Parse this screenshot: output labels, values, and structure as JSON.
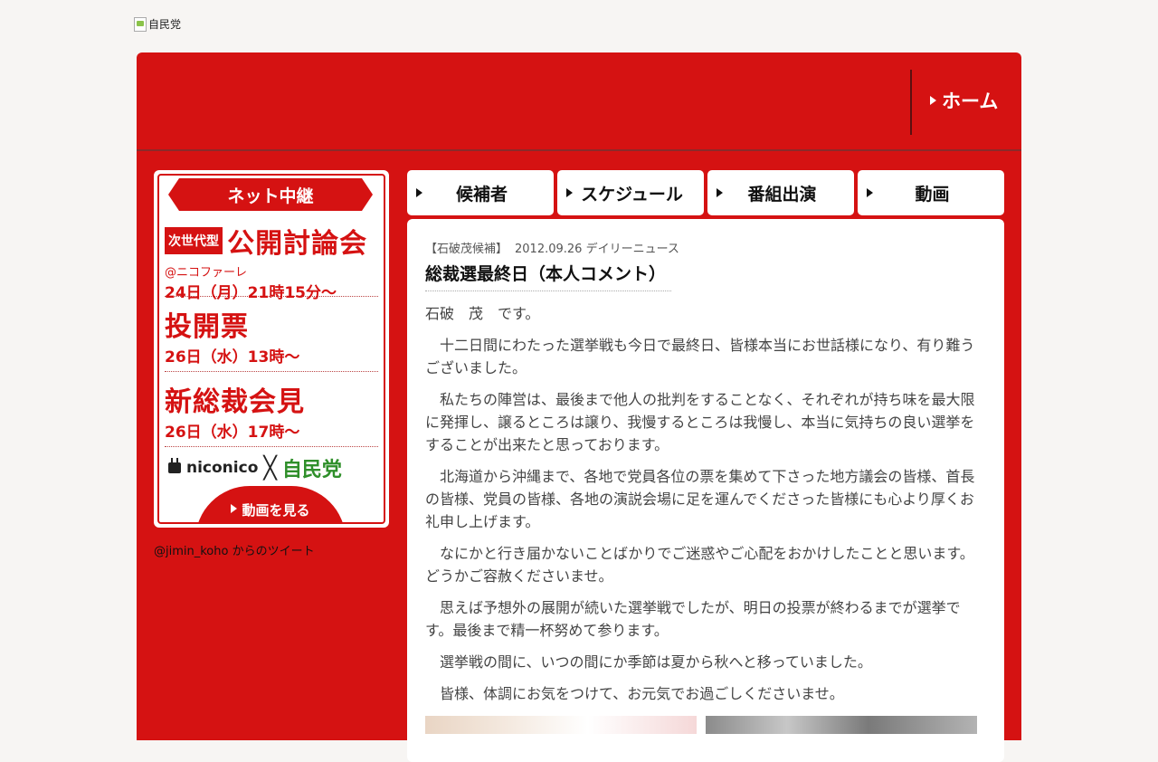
{
  "logo": {
    "alt": "自民党"
  },
  "nav": {
    "home": "ホーム"
  },
  "banner": {
    "ribbon": "ネット中継",
    "next_gen_tag": "次世代型",
    "debate_title": "公開討論会",
    "venue": "@ニコファーレ",
    "debate_time": "24日（月）21時15分～",
    "vote_title": "投開票",
    "vote_time": "26日（水）13時～",
    "press_title": "新総裁会見",
    "press_time": "26日（水）17時～",
    "partner_left": "niconico",
    "partner_cross": "╳",
    "partner_right": "自民党",
    "watch_button": "動画を見る"
  },
  "tweets": {
    "label": "@jimin_koho からのツイート"
  },
  "tabs": [
    {
      "label": "候補者"
    },
    {
      "label": "スケジュール"
    },
    {
      "label": "番組出演"
    },
    {
      "label": "動画"
    }
  ],
  "article": {
    "category": "【石破茂候補】",
    "date_source": "2012.09.26 デイリーニュース",
    "title": "総裁選最終日（本人コメント）",
    "signature": "石破　茂　です。",
    "paragraphs": [
      "　十二日間にわたった選挙戦も今日で最終日、皆様本当にお世話様になり、有り難うございました。",
      "　私たちの陣営は、最後まで他人の批判をすることなく、それぞれが持ち味を最大限に発揮し、譲るところは譲り、我慢するところは我慢し、本当に気持ちの良い選挙をすることが出来たと思っております。",
      "　北海道から沖縄まで、各地で党員各位の票を集めて下さった地方議会の皆様、首長の皆様、党員の皆様、各地の演説会場に足を運んでくださった皆様にも心より厚くお礼申し上げます。",
      "　なにかと行き届かないことばかりでご迷惑やご心配をおかけしたことと思います。どうかご容赦くださいませ。",
      "　思えば予想外の展開が続いた選挙戦でしたが、明日の投票が終わるまでが選挙です。最後まで精一杯努めて参ります。",
      "　選挙戦の間に、いつの間にか季節は夏から秋へと移っていました。",
      "　皆様、体調にお気をつけて、お元気でお過ごしくださいませ。"
    ]
  }
}
